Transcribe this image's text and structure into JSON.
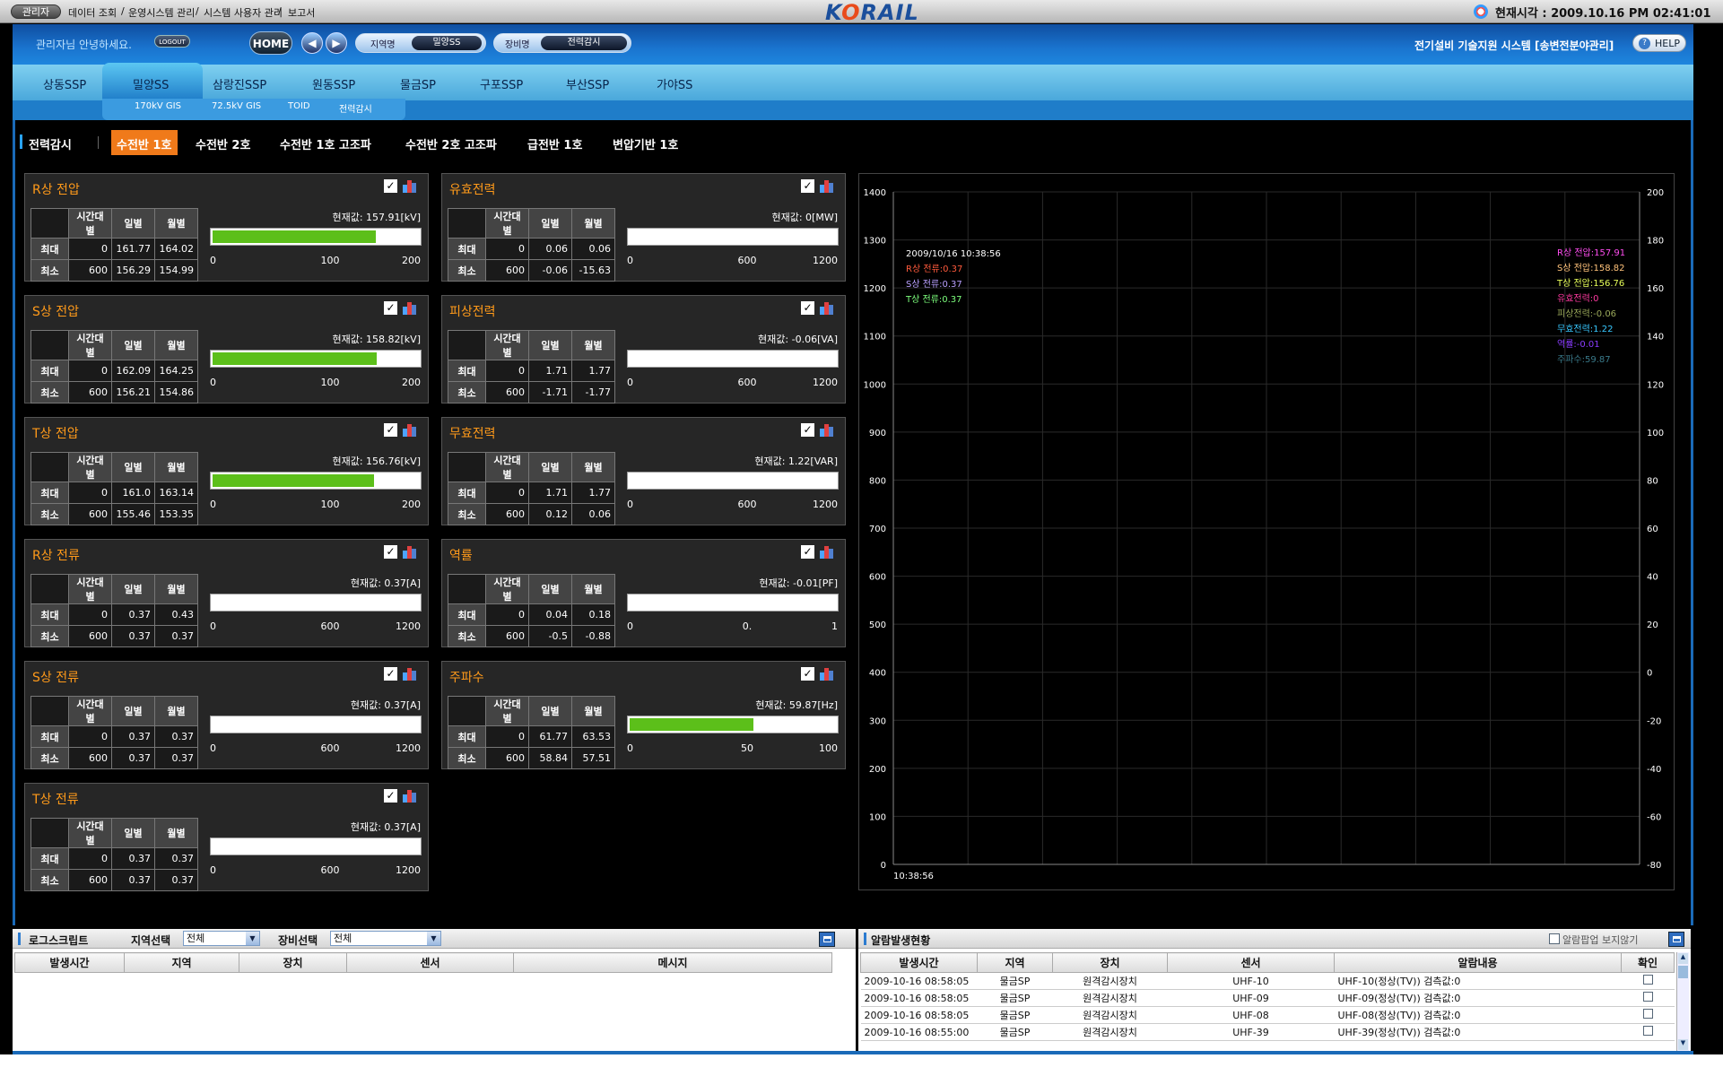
{
  "topbar": {
    "admin": "관리자",
    "nav": [
      "데이터 조회",
      "/",
      "운영시스템 관리",
      "/",
      "시스템 사용자 관리",
      "/",
      "보고서"
    ],
    "logo": "KORAIL",
    "clock": "현재시각 : 2009.10.16 PM 02:41:01"
  },
  "header": {
    "greeting": "관리자님 안녕하세요.",
    "logout": "LOGOUT",
    "home": "HOME",
    "region_key": "지역명",
    "region_val": "밀양SS",
    "equip_key": "장비명",
    "equip_val": "전력감시",
    "system_title": "전기설비 기술지원 시스템 [송변전분야관리]",
    "help": "HELP"
  },
  "tabs": [
    "상동SSP",
    "밀양SS",
    "삼랑진SSP",
    "원동SSP",
    "물금SP",
    "구포SSP",
    "부산SSP",
    "가야SS"
  ],
  "subtabs": [
    "170kV GIS",
    "72.5kV GIS",
    "TOID",
    "전력감시"
  ],
  "section": {
    "title": "전력감시",
    "tabs": [
      "수전반 1호",
      "수전반 2호",
      "수전반 1호 고조파",
      "수전반 2호 고조파",
      "급전반 1호",
      "변압기반 1호"
    ]
  },
  "cols": [
    "시간대별",
    "일별",
    "월별"
  ],
  "rowlabels": [
    "최대",
    "최소"
  ],
  "panels": [
    {
      "title": "R상 전압",
      "cur": "현재값: 157.91[kV]",
      "max": [
        "0",
        "161.77",
        "164.02"
      ],
      "min": [
        "600",
        "156.29",
        "154.99"
      ],
      "ticks": [
        "0",
        "100",
        "200"
      ],
      "fill": 0.79
    },
    {
      "title": "유효전력",
      "cur": "현재값: 0[MW]",
      "max": [
        "0",
        "0.06",
        "0.06"
      ],
      "min": [
        "600",
        "-0.06",
        "-15.63"
      ],
      "ticks": [
        "0",
        "600",
        "1200"
      ],
      "fill": 0
    },
    {
      "title": "S상 전압",
      "cur": "현재값: 158.82[kV]",
      "max": [
        "0",
        "162.09",
        "164.25"
      ],
      "min": [
        "600",
        "156.21",
        "154.86"
      ],
      "ticks": [
        "0",
        "100",
        "200"
      ],
      "fill": 0.794
    },
    {
      "title": "피상전력",
      "cur": "현재값: -0.06[VA]",
      "max": [
        "0",
        "1.71",
        "1.77"
      ],
      "min": [
        "600",
        "-1.71",
        "-1.77"
      ],
      "ticks": [
        "0",
        "600",
        "1200"
      ],
      "fill": 0
    },
    {
      "title": "T상 전압",
      "cur": "현재값: 156.76[kV]",
      "max": [
        "0",
        "161.0",
        "163.14"
      ],
      "min": [
        "600",
        "155.46",
        "153.35"
      ],
      "ticks": [
        "0",
        "100",
        "200"
      ],
      "fill": 0.784
    },
    {
      "title": "무효전력",
      "cur": "현재값: 1.22[VAR]",
      "max": [
        "0",
        "1.71",
        "1.77"
      ],
      "min": [
        "600",
        "0.12",
        "0.06"
      ],
      "ticks": [
        "0",
        "600",
        "1200"
      ],
      "fill": 0
    },
    {
      "title": "R상 전류",
      "cur": "현재값: 0.37[A]",
      "max": [
        "0",
        "0.37",
        "0.43"
      ],
      "min": [
        "600",
        "0.37",
        "0.37"
      ],
      "ticks": [
        "0",
        "600",
        "1200"
      ],
      "fill": 0
    },
    {
      "title": "역률",
      "cur": "현재값: -0.01[PF]",
      "max": [
        "0",
        "0.04",
        "0.18"
      ],
      "min": [
        "600",
        "-0.5",
        "-0.88"
      ],
      "ticks": [
        "0",
        "0.",
        "1"
      ],
      "fill": 0
    },
    {
      "title": "S상 전류",
      "cur": "현재값: 0.37[A]",
      "max": [
        "0",
        "0.37",
        "0.37"
      ],
      "min": [
        "600",
        "0.37",
        "0.37"
      ],
      "ticks": [
        "0",
        "600",
        "1200"
      ],
      "fill": 0
    },
    {
      "title": "주파수",
      "cur": "현재값: 59.87[Hz]",
      "max": [
        "0",
        "61.77",
        "63.53"
      ],
      "min": [
        "600",
        "58.84",
        "57.51"
      ],
      "ticks": [
        "0",
        "50",
        "100"
      ],
      "fill": 0.5987
    },
    {
      "title": "T상 전류",
      "cur": "현재값: 0.37[A]",
      "max": [
        "0",
        "0.37",
        "0.37"
      ],
      "min": [
        "600",
        "0.37",
        "0.37"
      ],
      "ticks": [
        "0",
        "600",
        "1200"
      ],
      "fill": 0
    }
  ],
  "chart_data": {
    "type": "line",
    "y_left": [
      0,
      100,
      200,
      300,
      400,
      500,
      600,
      700,
      800,
      900,
      1000,
      1100,
      1200,
      1300,
      1400
    ],
    "y_right": [
      -80,
      -60,
      -40,
      -20,
      0,
      20,
      40,
      60,
      80,
      100,
      120,
      140,
      160,
      180,
      200
    ],
    "ylim_left": [
      0,
      1400
    ],
    "ylim_right": [
      -80,
      200
    ],
    "x_ticks": [
      "10:38:56"
    ],
    "grid": true,
    "tooltip": {
      "time": "2009/10/16 10:38:56",
      "lines": [
        {
          "text": "R상 전류:0.37",
          "color": "#ff5a3c"
        },
        {
          "text": "S상 전류:0.37",
          "color": "#b9a0ff"
        },
        {
          "text": "T상 전류:0.37",
          "color": "#7dff7d"
        }
      ]
    },
    "legend": [
      {
        "text": "R상 전압:157.91",
        "color": "#ff4df0"
      },
      {
        "text": "S상 전압:158.82",
        "color": "#ffc27a"
      },
      {
        "text": "T상 전압:156.76",
        "color": "#e8ff5a"
      },
      {
        "text": "유효전력:0",
        "color": "#ff3aa0"
      },
      {
        "text": "피상전력:-0.06",
        "color": "#9aa85a"
      },
      {
        "text": "무효전력:1.22",
        "color": "#38c8ff"
      },
      {
        "text": "역률:-0.01",
        "color": "#8a3cff"
      },
      {
        "text": "주파수:59.87",
        "color": "#3a7a8a"
      }
    ]
  },
  "log": {
    "title": "로그스크립트",
    "region_label": "지역선택",
    "region_val": "전체",
    "equip_label": "장비선택",
    "equip_val": "전체",
    "cols": [
      "발생시간",
      "지역",
      "장치",
      "센서",
      "메시지"
    ]
  },
  "alarm": {
    "title": "알람발생현황",
    "popup": "알람팝업 보지않기",
    "cols": [
      "발생시간",
      "지역",
      "장치",
      "센서",
      "알람내용",
      "확인"
    ],
    "rows": [
      [
        "2009-10-16  08:58:05",
        "물금SP",
        "원격감시장치",
        "UHF-10",
        "UHF-10(정상(TV)) 검측값:0"
      ],
      [
        "2009-10-16  08:58:05",
        "물금SP",
        "원격감시장치",
        "UHF-09",
        "UHF-09(정상(TV)) 검측값:0"
      ],
      [
        "2009-10-16  08:58:05",
        "물금SP",
        "원격감시장치",
        "UHF-08",
        "UHF-08(정상(TV)) 검측값:0"
      ],
      [
        "2009-10-16  08:55:00",
        "물금SP",
        "원격감시장치",
        "UHF-39",
        "UHF-39(정상(TV)) 검측값:0"
      ]
    ]
  }
}
